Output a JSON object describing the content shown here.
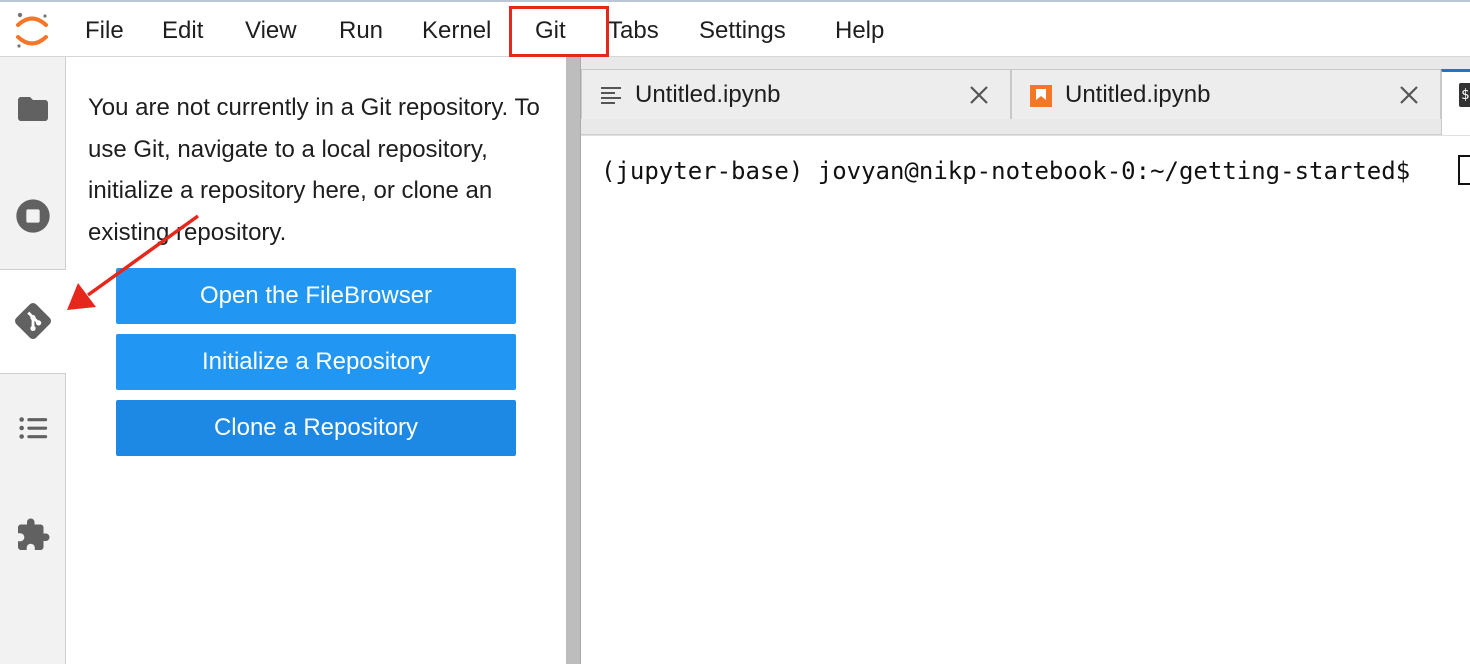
{
  "menubar": {
    "items": [
      "File",
      "Edit",
      "View",
      "Run",
      "Kernel",
      "Git",
      "Tabs",
      "Settings",
      "Help"
    ],
    "highlighted": "Git",
    "highlight_color": "#e5281b"
  },
  "activitybar": {
    "icons": [
      "folder-icon",
      "stop-circle-icon",
      "git-icon",
      "table-of-contents-icon",
      "extension-puzzle-icon"
    ],
    "active": "git-icon"
  },
  "git_panel": {
    "message": "You are not currently in a Git repository. To use Git, navigate to a local repository, initialize a repository here, or clone an existing repository.",
    "buttons": {
      "open_filebrowser": "Open the FileBrowser",
      "initialize": "Initialize a Repository",
      "clone": "Clone a Repository"
    },
    "button_color": "#2196f3",
    "button_color_pressed": "#1e88e5"
  },
  "tabs": [
    {
      "label": "Untitled.ipynb",
      "icon": "text-file-icon"
    },
    {
      "label": "Untitled.ipynb",
      "icon": "notebook-icon"
    },
    {
      "label": "",
      "icon": "terminal-icon"
    }
  ],
  "terminal": {
    "prompt": "(jupyter-base) jovyan@nikp-notebook-0:~/getting-started$ "
  },
  "annotation": {
    "arrow_color": "#e5281b"
  }
}
